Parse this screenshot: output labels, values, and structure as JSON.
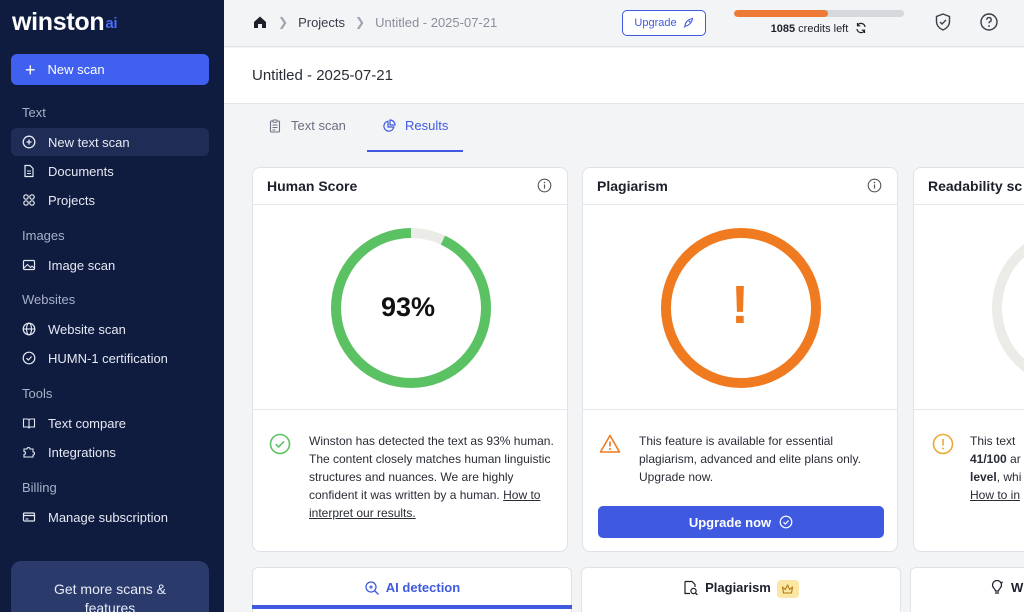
{
  "sidebar": {
    "logo_main": "winston",
    "logo_suffix": "ai",
    "new_scan": "New scan",
    "sections": [
      {
        "label": "Text"
      },
      {
        "label": "Images"
      },
      {
        "label": "Websites"
      },
      {
        "label": "Tools"
      },
      {
        "label": "Billing"
      }
    ],
    "items": [
      {
        "label": "New text scan",
        "icon": "plus-circle-icon"
      },
      {
        "label": "Documents",
        "icon": "document-icon"
      },
      {
        "label": "Projects",
        "icon": "grid-icon"
      },
      {
        "label": "Image scan",
        "icon": "image-icon"
      },
      {
        "label": "Website scan",
        "icon": "globe-icon"
      },
      {
        "label": "HUMN-1 certification",
        "icon": "check-circle-icon"
      },
      {
        "label": "Text compare",
        "icon": "book-icon"
      },
      {
        "label": "Integrations",
        "icon": "puzzle-icon"
      },
      {
        "label": "Manage subscription",
        "icon": "card-icon"
      }
    ],
    "promo_line1": "Get more scans &",
    "promo_line2": "features"
  },
  "topbar": {
    "breadcrumb": [
      "Projects",
      "Untitled - 2025-07-21"
    ],
    "upgrade": "Upgrade",
    "credits_count": "1085",
    "credits_suffix": " credits left",
    "credits_used_fraction": 0.55
  },
  "page": {
    "title": "Untitled - 2025-07-21"
  },
  "tabs": [
    {
      "label": "Text scan"
    },
    {
      "label": "Results"
    }
  ],
  "cards": {
    "human": {
      "title": "Human Score",
      "score": "93%",
      "score_value": 0.93,
      "desc": "Winston has detected the text as 93% human. The content closely matches human linguistic structures and nuances. We are highly confident it was written by a human.",
      "link": "How to interpret our results."
    },
    "plagiarism": {
      "title": "Plagiarism",
      "symbol": "!",
      "desc": "This feature is available for essential plagiarism, advanced and elite plans only. Upgrade now.",
      "button": "Upgrade now"
    },
    "readability": {
      "title": "Readability sc",
      "line1": "This text",
      "line2": "41/100",
      "line2_suffix": " ar",
      "line3": "level",
      "line3_suffix": ", whi",
      "line4": "How to in"
    }
  },
  "bottom_tabs": [
    {
      "label": "AI detection"
    },
    {
      "label": "Plagiarism"
    },
    {
      "label": "W"
    }
  ],
  "colors": {
    "accent": "#3f5ae0",
    "human_ring": "#5bc264",
    "plagiarism_ring": "#f07a20",
    "credits_bar": "#ee7b35"
  }
}
